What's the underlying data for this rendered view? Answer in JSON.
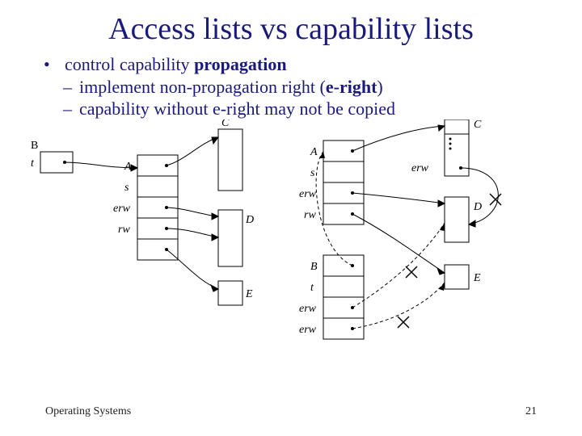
{
  "title": "Access lists vs capability lists",
  "bullets": {
    "b1": "control capability",
    "b1_strong": "propagation",
    "s1a": "implement non-propagation right (",
    "s1a_strong": "e-right",
    "s1a_tail": ")",
    "s2": "capability without e-right may not be copied"
  },
  "footer": {
    "left": "Operating Systems",
    "right": "21"
  },
  "labels": {
    "B": "B",
    "t": "t",
    "A": "A",
    "s": "s",
    "erw": "erw",
    "rw": "rw",
    "C": "C",
    "D": "D",
    "E": "E"
  }
}
